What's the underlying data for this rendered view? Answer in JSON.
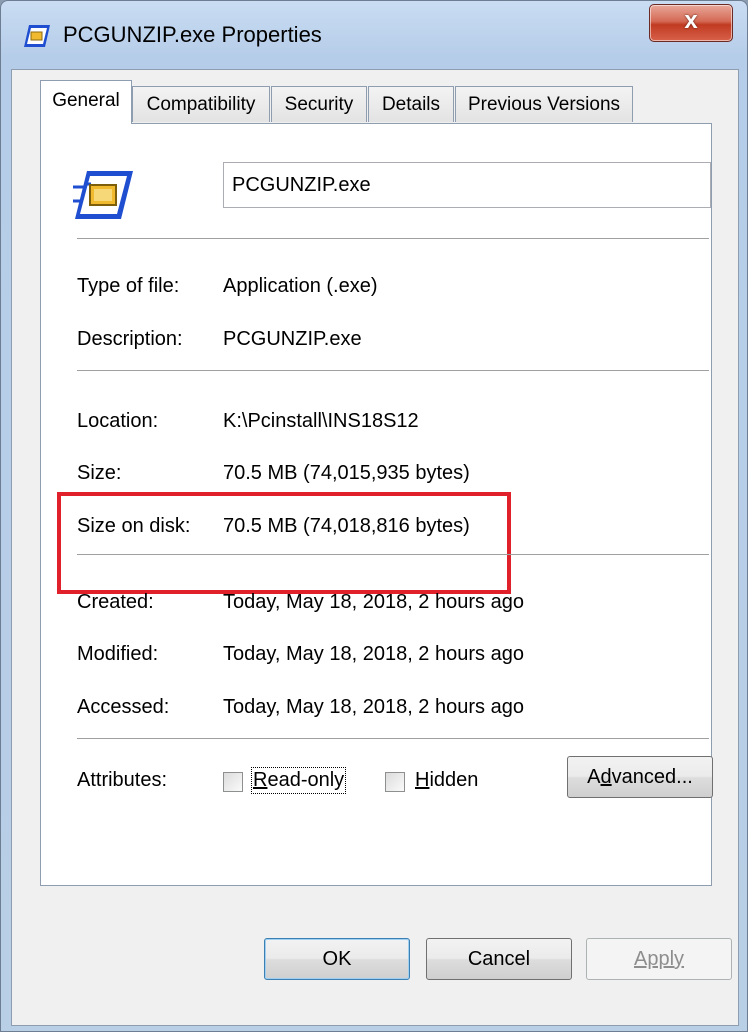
{
  "window": {
    "title": "PCGUNZIP.exe Properties",
    "close_glyph": "x"
  },
  "tabs": [
    {
      "label": "General"
    },
    {
      "label": "Compatibility"
    },
    {
      "label": "Security"
    },
    {
      "label": "Details"
    },
    {
      "label": "Previous Versions"
    }
  ],
  "general": {
    "file_name": "PCGUNZIP.exe",
    "type_label": "Type of file:",
    "type_value": "Application (.exe)",
    "description_label": "Description:",
    "description_value": "PCGUNZIP.exe",
    "location_label": "Location:",
    "location_value": "K:\\Pcinstall\\INS18S12",
    "size_label": "Size:",
    "size_value": "70.5 MB (74,015,935 bytes)",
    "size_on_disk_label": "Size on disk:",
    "size_on_disk_value": "70.5 MB (74,018,816 bytes)",
    "created_label": "Created:",
    "created_value": "Today, May 18, 2018, 2 hours ago",
    "modified_label": "Modified:",
    "modified_value": "Today, May 18, 2018, 2 hours ago",
    "accessed_label": "Accessed:",
    "accessed_value": "Today, May 18, 2018, 2 hours ago",
    "attributes_label": "Attributes:",
    "readonly": {
      "underlined": "R",
      "rest": "ead-only",
      "checked": false
    },
    "hidden": {
      "underlined": "H",
      "rest": "idden",
      "checked": false
    },
    "advanced": {
      "before": "A",
      "underlined": "d",
      "after": "vanced..."
    }
  },
  "buttons": {
    "ok": "OK",
    "cancel": "Cancel",
    "apply": "Apply"
  },
  "colors": {
    "highlight_box": "#e0202a",
    "close_button": "#c13b22"
  }
}
